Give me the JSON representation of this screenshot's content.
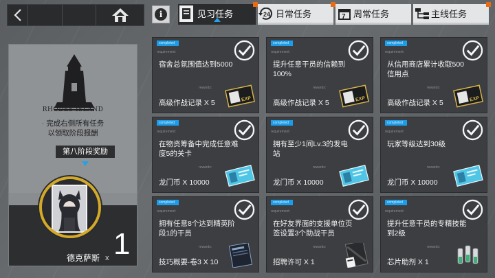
{
  "tabs": [
    {
      "label": "见习任务",
      "active": true,
      "notify": true
    },
    {
      "label": "日常任务",
      "active": false,
      "notify": true
    },
    {
      "label": "周常任务",
      "active": false,
      "notify": false
    },
    {
      "label": "主线任务",
      "active": false,
      "notify": true
    }
  ],
  "left_panel": {
    "logo_text": "RHODES ISLAND",
    "hint_line1": "· 完成右侧所有任务",
    "hint_line2": "以领取阶段报酬",
    "stage_label": "第八阶段奖励",
    "reward_name": "德克萨斯",
    "reward_x": "x",
    "reward_count": "1"
  },
  "cards": [
    {
      "status": "completed",
      "req_label": "requirement:",
      "desc": "宿舍总氛围值达到5000",
      "rewards_label": "rewards:",
      "reward": "高级作战记录 X 5",
      "item": "exp-card"
    },
    {
      "status": "completed",
      "req_label": "requirement:",
      "desc": "提升任意干员的信赖到100%",
      "rewards_label": "rewards:",
      "reward": "高级作战记录 X 5",
      "item": "exp-card"
    },
    {
      "status": "completed",
      "req_label": "requirement:",
      "desc": "从信用商店累计收取500信用点",
      "rewards_label": "rewards:",
      "reward": "高级作战记录 X 5",
      "item": "exp-card"
    },
    {
      "status": "completed",
      "req_label": "requirement:",
      "desc": "在物资筹备中完成任意难度5的关卡",
      "rewards_label": "rewards:",
      "reward": "龙门币 X 10000",
      "item": "lmd-card"
    },
    {
      "status": "completed",
      "req_label": "requirement:",
      "desc": "拥有至少1间Lv.3的发电站",
      "rewards_label": "rewards:",
      "reward": "龙门币 X 10000",
      "item": "lmd-card"
    },
    {
      "status": "completed",
      "req_label": "requirement:",
      "desc": "玩家等级达到30级",
      "rewards_label": "rewards:",
      "reward": "龙门币 X 10000",
      "item": "lmd-card"
    },
    {
      "status": "completed",
      "req_label": "requirement:",
      "desc": "拥有任意8个达到精英阶段1的干员",
      "rewards_label": "rewards:",
      "reward": "技巧概要·卷3 X 10",
      "item": "skill-book"
    },
    {
      "status": "completed",
      "req_label": "requirement:",
      "desc": "在好友界面的支援单位页签设置3个助战干员",
      "rewards_label": "rewards:",
      "reward": "招聘许可 X 1",
      "item": "recruit-permit"
    },
    {
      "status": "completed",
      "req_label": "requirement:",
      "desc": "提升任意干员的专精技能到2级",
      "rewards_label": "rewards:",
      "reward": "芯片助剂 X 1",
      "item": "chip-catalyst"
    }
  ],
  "colors": {
    "accent": "#1d9ce8",
    "badge_notify": "#e96a10",
    "reward_ring": "#d4a928",
    "card_bg": "#3c3e41"
  }
}
